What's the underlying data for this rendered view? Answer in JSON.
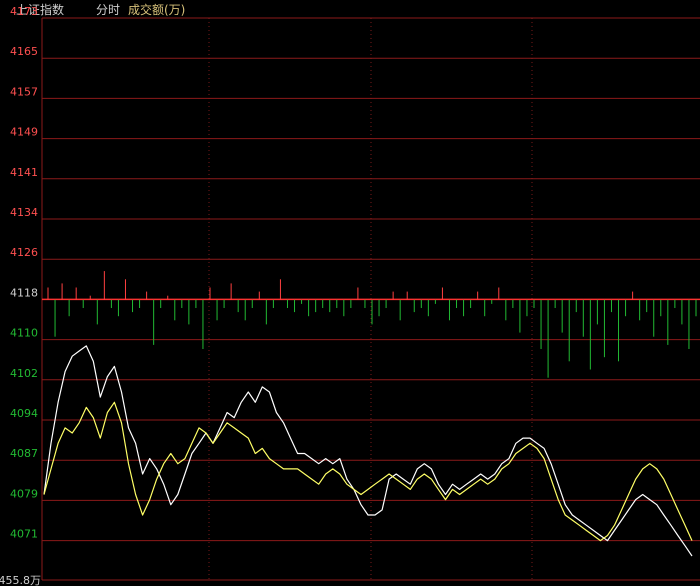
{
  "header": {
    "index_name": "上证指数",
    "mode": "分时",
    "volume_label": "成交额(万)"
  },
  "colors": {
    "grid_red": "#8b1a1a",
    "grid_dash": "#7a1a1a",
    "price_up": "#ff5050",
    "price_down": "#22bb33",
    "base": "#ff3030",
    "white_line": "#ffffff",
    "yellow_line": "#ffff66",
    "bar_up": "#ff4040",
    "bar_down": "#22bb33"
  },
  "chart_data": {
    "type": "line",
    "base_price": 4118,
    "ylim": [
      4063,
      4173
    ],
    "y_ticks": [
      "4173",
      "4165",
      "4157",
      "4149",
      "4141",
      "4134",
      "4126",
      "4118",
      "4110",
      "4102",
      "4094",
      "4087",
      "4079",
      "4071"
    ],
    "bottom_label": "455.8万",
    "series": [
      {
        "key": "white",
        "values": [
          4080,
          4090,
          4098,
          4104,
          4107,
          4108,
          4109,
          4106,
          4099,
          4103,
          4105,
          4100,
          4093,
          4090,
          4084,
          4087,
          4085,
          4082,
          4078,
          4080,
          4084,
          4088,
          4090,
          4092,
          4090,
          4093,
          4096,
          4095,
          4098,
          4100,
          4098,
          4101,
          4100,
          4096,
          4094,
          4091,
          4088,
          4088,
          4087,
          4086,
          4087,
          4086,
          4087,
          4083,
          4081,
          4078,
          4076,
          4076,
          4077,
          4083,
          4084,
          4083,
          4082,
          4085,
          4086,
          4085,
          4082,
          4080,
          4082,
          4081,
          4082,
          4083,
          4084,
          4083,
          4084,
          4086,
          4087,
          4090,
          4091,
          4091,
          4090,
          4089,
          4086,
          4082,
          4078,
          4076,
          4075,
          4074,
          4073,
          4072,
          4071,
          4073,
          4075,
          4077,
          4079,
          4080,
          4079,
          4078,
          4076,
          4074,
          4072,
          4070,
          4068
        ]
      },
      {
        "key": "yellow",
        "values": [
          4080,
          4085,
          4090,
          4093,
          4092,
          4094,
          4097,
          4095,
          4091,
          4096,
          4098,
          4094,
          4086,
          4080,
          4076,
          4079,
          4083,
          4086,
          4088,
          4086,
          4087,
          4090,
          4093,
          4092,
          4090,
          4092,
          4094,
          4093,
          4092,
          4091,
          4088,
          4089,
          4087,
          4086,
          4085,
          4085,
          4085,
          4084,
          4083,
          4082,
          4084,
          4085,
          4084,
          4082,
          4081,
          4080,
          4081,
          4082,
          4083,
          4084,
          4083,
          4082,
          4081,
          4083,
          4084,
          4083,
          4081,
          4079,
          4081,
          4080,
          4081,
          4082,
          4083,
          4082,
          4083,
          4085,
          4086,
          4088,
          4089,
          4090,
          4089,
          4087,
          4083,
          4079,
          4076,
          4075,
          4074,
          4073,
          4072,
          4071,
          4072,
          4074,
          4077,
          4080,
          4083,
          4085,
          4086,
          4085,
          4083,
          4080,
          4077,
          4074,
          4071
        ]
      }
    ],
    "volume_bars": [
      3,
      -9,
      4,
      -4,
      3,
      -2,
      1,
      -6,
      7,
      -2,
      -4,
      5,
      -3,
      -2,
      2,
      -11,
      -2,
      1,
      -5,
      -2,
      -6,
      -2,
      -12,
      3,
      -5,
      -2,
      4,
      -3,
      -5,
      -2,
      2,
      -6,
      -2,
      5,
      -2,
      -3,
      -1,
      -4,
      -3,
      -2,
      -3,
      -2,
      -4,
      -2,
      3,
      -2,
      -6,
      -4,
      -2,
      2,
      -5,
      2,
      -3,
      -2,
      -4,
      -1,
      3,
      -5,
      -2,
      -4,
      -2,
      2,
      -4,
      -1,
      3,
      -5,
      -2,
      -8,
      -4,
      -2,
      -12,
      -19,
      -2,
      -8,
      -15,
      -3,
      -9,
      -17,
      -6,
      -14,
      -3,
      -15,
      -4,
      2,
      -5,
      -3,
      -9,
      -4,
      -11,
      -2,
      -6,
      -12,
      -4
    ]
  }
}
